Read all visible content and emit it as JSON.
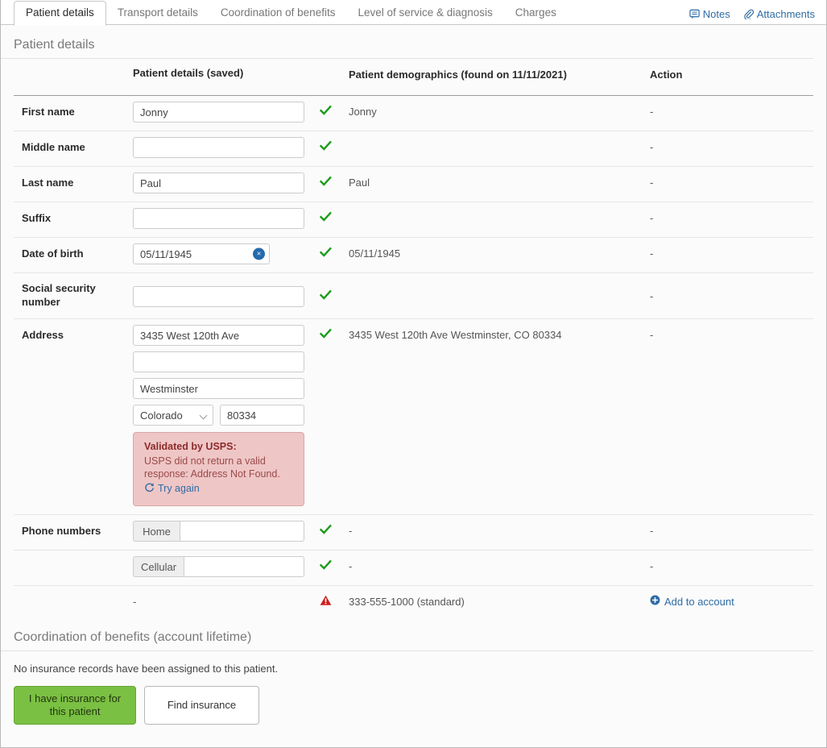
{
  "tabs": [
    {
      "label": "Patient details",
      "active": true
    },
    {
      "label": "Transport details",
      "active": false
    },
    {
      "label": "Coordination of benefits",
      "active": false
    },
    {
      "label": "Level of service & diagnosis",
      "active": false
    },
    {
      "label": "Charges",
      "active": false
    }
  ],
  "toolbar": {
    "notes_label": "Notes",
    "attachments_label": "Attachments",
    "notes_icon": "comment-icon",
    "attachments_icon": "paperclip-icon"
  },
  "patient_section": {
    "title": "Patient details",
    "columns": {
      "blank": "",
      "saved": "Patient details (saved)",
      "demographics": "Patient demographics (found on 11/11/2021)",
      "action": "Action"
    },
    "rows": {
      "first_name": {
        "label": "First name",
        "value": "Jonny",
        "status": "ok",
        "demographics": "Jonny",
        "action": "-"
      },
      "middle_name": {
        "label": "Middle name",
        "value": "",
        "status": "ok",
        "demographics": "",
        "action": "-"
      },
      "last_name": {
        "label": "Last name",
        "value": "Paul",
        "status": "ok",
        "demographics": "Paul",
        "action": "-"
      },
      "suffix": {
        "label": "Suffix",
        "value": "",
        "status": "ok",
        "demographics": "",
        "action": "-"
      },
      "date_of_birth": {
        "label": "Date of birth",
        "value": "05/11/1945",
        "clear_label": "×",
        "status": "ok",
        "demographics": "05/11/1945",
        "action": "-"
      },
      "ssn": {
        "label": "Social security number",
        "value": "",
        "status": "ok",
        "demographics": "",
        "action": "-"
      },
      "address": {
        "label": "Address",
        "line1": "3435 West 120th Ave",
        "line2": "",
        "city": "Westminster",
        "state": "Colorado",
        "zip": "80334",
        "status": "ok",
        "demographics": "3435 West 120th Ave Westminster, CO 80334",
        "action": "-",
        "validation": {
          "title": "Validated by USPS:",
          "message": "USPS did not return a valid response: Address Not Found.",
          "retry_label": "Try again",
          "retry_icon": "refresh-icon",
          "bg_color": "#efc6c6",
          "border_color": "#d9a6a6",
          "title_color": "#8c2b2b"
        }
      },
      "phone_numbers": {
        "label": "Phone numbers",
        "entries": [
          {
            "type": "Home",
            "value": "",
            "status": "ok",
            "demographics": "-",
            "action": "-"
          },
          {
            "type": "Cellular",
            "value": "",
            "status": "ok",
            "demographics": "-",
            "action": "-"
          }
        ],
        "unmatched": {
          "saved": "-",
          "status": "warning",
          "demographics": "333-555-1000 (standard)",
          "action_label": "Add to account",
          "action_icon": "plus-circle-icon"
        }
      }
    }
  },
  "cob_section": {
    "title": "Coordination of benefits (account lifetime)",
    "empty_message": "No insurance records have been assigned to this patient.",
    "primary_button": "I have insurance for this patient",
    "secondary_button": "Find insurance"
  },
  "colors": {
    "success": "#1a9c1a",
    "warning": "#cc1f1f",
    "link": "#2e6ca4",
    "primary_button": "#7ac043"
  }
}
